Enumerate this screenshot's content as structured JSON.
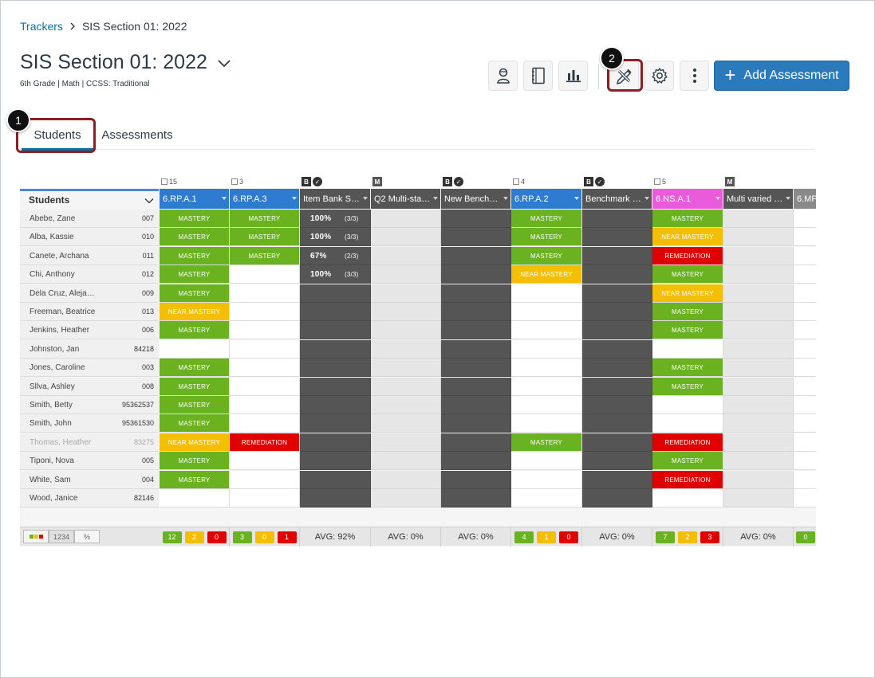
{
  "breadcrumb": {
    "root": "Trackers",
    "current": "SIS Section 01: 2022"
  },
  "title": "SIS Section 01: 2022",
  "subtitle": "6th Grade  |  Math  |  CCSS: Traditional",
  "toolbar": {
    "add_assessment": "Add Assessment"
  },
  "callouts": {
    "one": "1",
    "two": "2"
  },
  "tabs": {
    "students": "Students",
    "assessments": "Assessments"
  },
  "grid": {
    "students_header": "Students",
    "columns": [
      {
        "header": "6.RP.A.1",
        "badge": "15",
        "color": "#2f7bd1"
      },
      {
        "header": "6.RP.A.3",
        "badge": "3",
        "color": "#2f7bd1"
      },
      {
        "header": "Item Bank S…",
        "badge": "B",
        "color": "#555555"
      },
      {
        "header": "Q2 Multi-sta…",
        "badge": "M",
        "color": "#555555"
      },
      {
        "header": "New Bench…",
        "badge": "B",
        "color": "#555555"
      },
      {
        "header": "6.RP.A.2",
        "badge": "4",
        "color": "#2f7bd1"
      },
      {
        "header": "Benchmark …",
        "badge": "B",
        "color": "#555555"
      },
      {
        "header": "6.NS.A.1",
        "badge": "5",
        "color": "#ea5bdb"
      },
      {
        "header": "Multi varied …",
        "badge": "M",
        "color": "#555555"
      },
      {
        "header": "6.MP",
        "color": "#8a8a8a"
      }
    ],
    "labels": {
      "mastery": "MASTERY",
      "near_mastery": "NEAR MASTERY",
      "remediation": "REMEDIATION"
    },
    "students": [
      {
        "name": "Abebe, Zane",
        "id": "007"
      },
      {
        "name": "Alba, Kassie",
        "id": "010"
      },
      {
        "name": "Canete, Archana",
        "id": "011"
      },
      {
        "name": "Chi, Anthony",
        "id": "012"
      },
      {
        "name": "Dela Cruz, Aleja…",
        "id": "009"
      },
      {
        "name": "Freeman, Beatrice",
        "id": "013"
      },
      {
        "name": "Jenkins, Heather",
        "id": "006"
      },
      {
        "name": "Johnston, Jan",
        "id": "84218"
      },
      {
        "name": "Jones, Caroline",
        "id": "003"
      },
      {
        "name": "Sllva, Ashley",
        "id": "008"
      },
      {
        "name": "Smith, Betty",
        "id": "95362537"
      },
      {
        "name": "Smith, John",
        "id": "95361530"
      },
      {
        "name": "Thomas, Heather",
        "id": "83275",
        "muted": true
      },
      {
        "name": "Tiponi, Nova",
        "id": "005"
      },
      {
        "name": "White, Sam",
        "id": "004"
      },
      {
        "name": "Wood, Janice",
        "id": "82146"
      }
    ],
    "cells": [
      [
        "M",
        "M",
        "S1",
        "G",
        "D",
        "M",
        "D",
        "M",
        "G",
        "E"
      ],
      [
        "M",
        "M",
        "S2",
        "G",
        "D",
        "M",
        "D",
        "N",
        "G",
        "E"
      ],
      [
        "M",
        "M",
        "S3",
        "G",
        "D",
        "M",
        "D",
        "R",
        "G",
        "E"
      ],
      [
        "M",
        "E",
        "S4",
        "G",
        "D",
        "N",
        "D",
        "M",
        "G",
        "E"
      ],
      [
        "M",
        "E",
        "D",
        "G",
        "D",
        "E",
        "D",
        "N",
        "G",
        "E"
      ],
      [
        "N",
        "E",
        "D",
        "G",
        "D",
        "E",
        "D",
        "M",
        "G",
        "E"
      ],
      [
        "M",
        "E",
        "D",
        "G",
        "D",
        "E",
        "D",
        "M",
        "G",
        "E"
      ],
      [
        "E",
        "E",
        "D",
        "G",
        "D",
        "E",
        "D",
        "E",
        "G",
        "E"
      ],
      [
        "M",
        "E",
        "D",
        "G",
        "D",
        "E",
        "D",
        "M",
        "G",
        "E"
      ],
      [
        "M",
        "E",
        "D",
        "G",
        "D",
        "E",
        "D",
        "M",
        "G",
        "E"
      ],
      [
        "M",
        "E",
        "D",
        "G",
        "D",
        "E",
        "D",
        "E",
        "G",
        "E"
      ],
      [
        "M",
        "E",
        "D",
        "G",
        "D",
        "E",
        "D",
        "E",
        "G",
        "E"
      ],
      [
        "N",
        "R",
        "D",
        "G",
        "D",
        "M",
        "D",
        "R",
        "G",
        "E"
      ],
      [
        "M",
        "E",
        "D",
        "G",
        "D",
        "E",
        "D",
        "M",
        "G",
        "E"
      ],
      [
        "M",
        "E",
        "D",
        "G",
        "D",
        "E",
        "D",
        "R",
        "G",
        "E"
      ],
      [
        "E",
        "E",
        "D",
        "G",
        "D",
        "E",
        "D",
        "E",
        "G",
        "E"
      ]
    ],
    "scores": {
      "S1": {
        "pct": "100%",
        "frac": "(3/3)"
      },
      "S2": {
        "pct": "100%",
        "frac": "(3/3)"
      },
      "S3": {
        "pct": "67%",
        "frac": "(2/3)"
      },
      "S4": {
        "pct": "100%",
        "frac": "(3/3)"
      }
    },
    "footer": {
      "controls": {
        "numbers": "1234",
        "percent": "%"
      },
      "c1": [
        "12",
        "2",
        "0"
      ],
      "c2": [
        "3",
        "0",
        "1"
      ],
      "c3": "AVG: 92%",
      "c4": "AVG: 0%",
      "c5": "AVG: 0%",
      "c6": [
        "4",
        "1",
        "0"
      ],
      "c7": "AVG: 0%",
      "c8": [
        "7",
        "2",
        "3"
      ],
      "c9": "AVG: 0%",
      "c10": "0"
    }
  }
}
